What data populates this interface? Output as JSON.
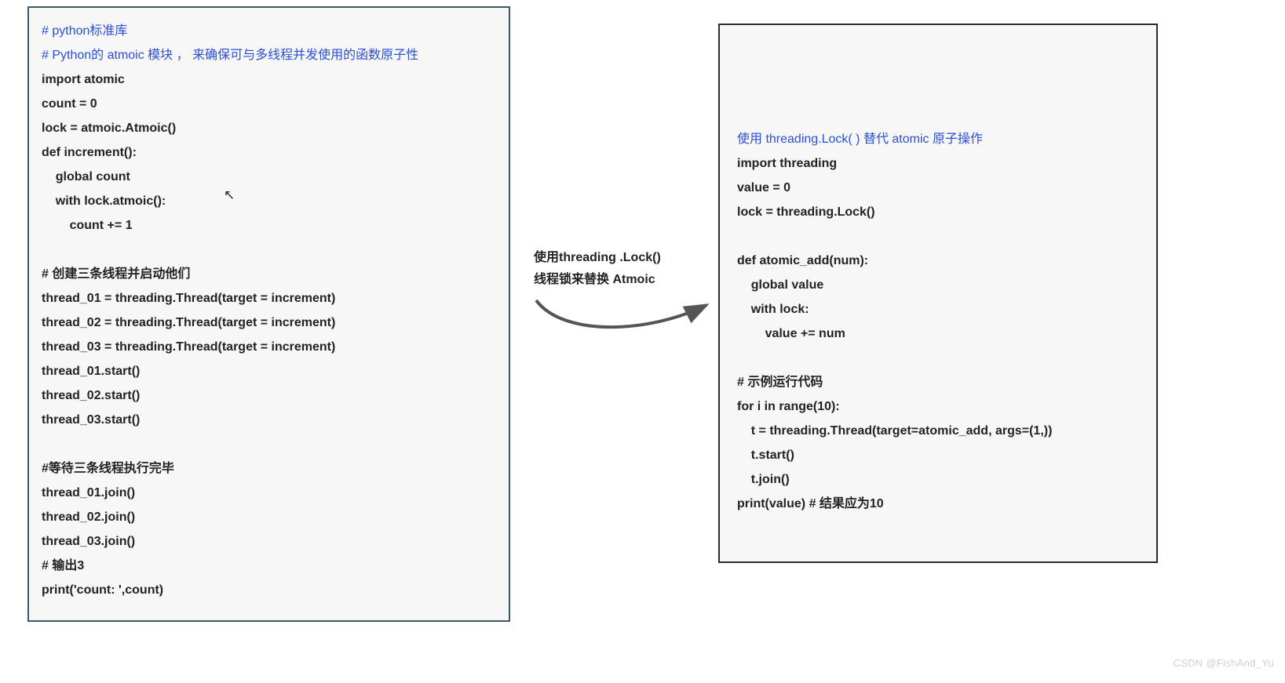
{
  "left": {
    "c1": "# python标准库",
    "c2": "# Python的 atmoic 模块 ， 来确保可与多线程并发使用的函数原子性",
    "l1": "import atomic",
    "l2": "count = 0",
    "l3": "lock = atmoic.Atmoic()",
    "l4": "def increment():",
    "l5": "    global count",
    "l6": "    with lock.atmoic():",
    "l7": "        count += 1",
    "blank1": " ",
    "c3": "# 创建三条线程并启动他们",
    "l8": "thread_01 = threading.Thread(target = increment)",
    "l9": "thread_02 = threading.Thread(target = increment)",
    "l10": "thread_03 = threading.Thread(target = increment)",
    "l11": "thread_01.start()",
    "l12": "thread_02.start()",
    "l13": "thread_03.start()",
    "blank2": " ",
    "c4": "#等待三条线程执行完毕",
    "l14": "thread_01.join()",
    "l15": "thread_02.join()",
    "l16": "thread_03.join()",
    "c5": "# 输出3",
    "l17": "print('count: ',count)"
  },
  "mid": {
    "t1": "使用threading .Lock()",
    "t2": "线程锁来替换 Atmoic"
  },
  "right": {
    "c1": "使用 threading.Lock( ) 替代 atomic 原子操作",
    "l1": "import threading",
    "l2": "value = 0",
    "l3": "lock = threading.Lock()",
    "blank1": " ",
    "l4": "def atomic_add(num):",
    "l5": "    global value",
    "l6": "    with lock:",
    "l7": "        value += num",
    "blank2": " ",
    "c2": "# 示例运行代码",
    "l8": "for i in range(10):",
    "l9": "    t = threading.Thread(target=atomic_add, args=(1,))",
    "l10": "    t.start()",
    "l11": "    t.join()",
    "l12": "print(value) # 结果应为10"
  },
  "watermark": "CSDN @FishAnd_Yu"
}
